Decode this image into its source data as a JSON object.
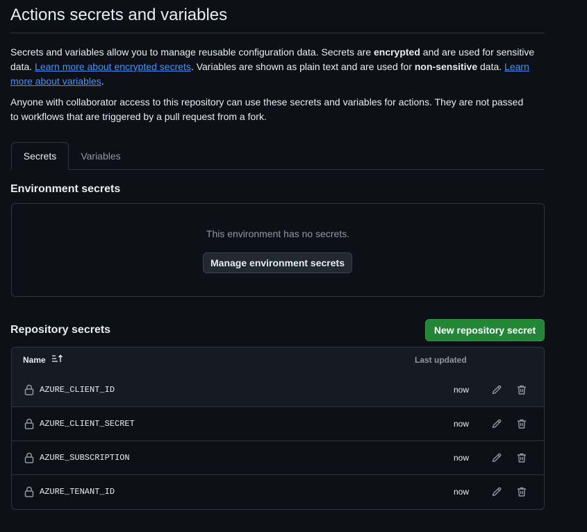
{
  "page": {
    "title": "Actions secrets and variables"
  },
  "intro": {
    "p1_a": "Secrets and variables allow you to manage reusable configuration data. Secrets are ",
    "p1_b": "encrypted",
    "p1_c": " and are used for sensitive data. ",
    "p1_link1": "Learn more about encrypted secrets",
    "p1_d": ". Variables are shown as plain text and are used for ",
    "p1_e": "non-sensitive",
    "p1_f": " data. ",
    "p1_link2": "Learn more about variables",
    "p1_g": ".",
    "p2": "Anyone with collaborator access to this repository can use these secrets and variables for actions. They are not passed to workflows that are triggered by a pull request from a fork."
  },
  "tabs": [
    {
      "label": "Secrets",
      "active": true
    },
    {
      "label": "Variables",
      "active": false
    }
  ],
  "environment": {
    "heading": "Environment secrets",
    "empty_text": "This environment has no secrets.",
    "manage_button": "Manage environment secrets"
  },
  "repository": {
    "heading": "Repository secrets",
    "new_button": "New repository secret",
    "columns": {
      "name": "Name",
      "updated": "Last updated"
    },
    "secrets": [
      {
        "name": "AZURE_CLIENT_ID",
        "updated": "now"
      },
      {
        "name": "AZURE_CLIENT_SECRET",
        "updated": "now"
      },
      {
        "name": "AZURE_SUBSCRIPTION",
        "updated": "now"
      },
      {
        "name": "AZURE_TENANT_ID",
        "updated": "now"
      }
    ]
  },
  "colors": {
    "background": "#0d1117",
    "border": "#30363d",
    "link": "#4493f8",
    "primary_button": "#238636",
    "muted_text": "#9198a1"
  }
}
